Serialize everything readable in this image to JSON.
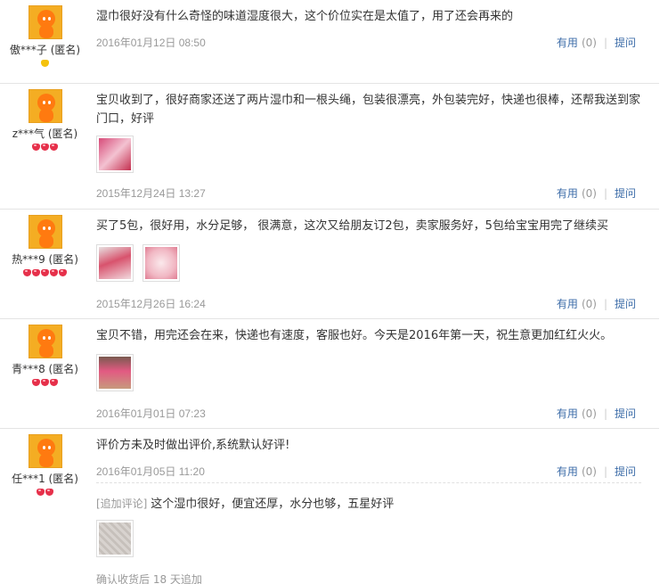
{
  "ops": {
    "useful_label": "有用",
    "useful_count": "(0)",
    "ask_label": "提问"
  },
  "reviews": [
    {
      "user": "傲***子 (匿名)",
      "text": "湿巾很好没有什么奇怪的味道湿度很大，这个价位实在是太值了，用了还会再来的",
      "date": "2016年01月12日 08:50",
      "rank_gems": 0
    },
    {
      "user": "z***气 (匿名)",
      "text": "宝贝收到了，很好商家还送了两片湿巾和一根头绳，包装很漂亮，外包装完好，快递也很棒，还帮我送到家门口，好评",
      "date": "2015年12月24日 13:27",
      "rank_gems": 3
    },
    {
      "user": "热***9 (匿名)",
      "text": "买了5包，很好用，水分足够， 很满意，这次又给朋友订2包，卖家服务好，5包给宝宝用完了继续买",
      "date": "2015年12月26日 16:24",
      "rank_gems": 5
    },
    {
      "user": "青***8 (匿名)",
      "text": "宝贝不错，用完还会在来，快递也有速度，客服也好。今天是2016年第一天，祝生意更加红红火火。",
      "date": "2016年01月01日 07:23",
      "rank_gems": 3
    },
    {
      "user": "任***1 (匿名)",
      "text": "评价方未及时做出评价,系统默认好评!",
      "date": "2016年01月05日 11:20",
      "rank_gems": 2,
      "append_tag": "[追加评论]",
      "append_text": "这个湿巾很好，便宜还厚，水分也够，五星好评",
      "append_note": "确认收货后 18 天追加"
    }
  ],
  "colors": {
    "link": "#3c6ca8",
    "muted": "#999999",
    "avatar": "#f4ad23",
    "gem": "#e6304a"
  }
}
